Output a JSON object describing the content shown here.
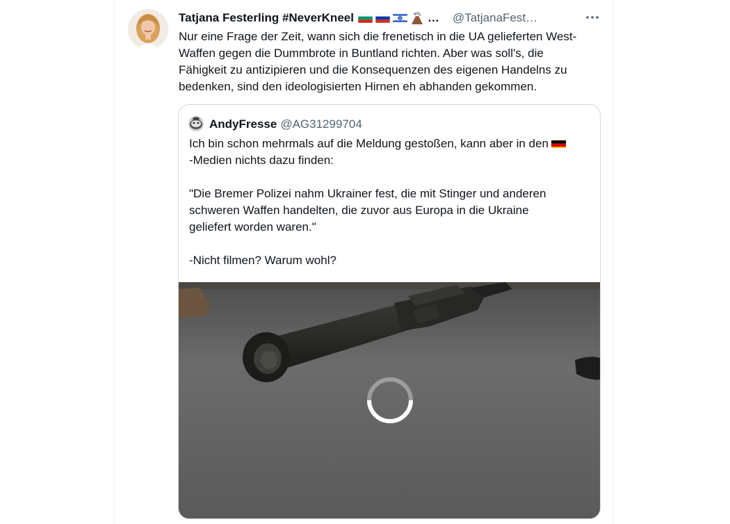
{
  "tweet": {
    "display_name": "Tatjana Festerling #NeverKneel",
    "name_suffix": "…",
    "handle": "@TatjanaFest…",
    "more_label": "···",
    "text_lines": [
      "Nur eine Frage der Zeit, wann sich die frenetisch in die UA gelieferten West-",
      "Waffen gegen die Dummbrote in Buntland richten. Aber was soll's, die",
      "Fähigkeit zu antizipieren und die Konsequenzen des eigenen Handelns zu",
      "bedenken, sind den ideologisierten Hirnen eh abhanden gekommen."
    ],
    "name_icons": [
      "flag-bulgaria-icon",
      "flag-russia-icon",
      "flag-israel-icon",
      "volcano-icon"
    ]
  },
  "quote": {
    "display_name": "AndyFresse",
    "handle": "@AG31299704",
    "lines": [
      "Ich bin schon mehrmals auf die Meldung gestoßen, kann aber in den",
      "-Medien nichts dazu finden:",
      "",
      "\"Die Bremer Polizei nahm Ukrainer fest, die mit Stinger und anderen",
      "schweren Waffen handelten, die zuvor aus Europa in die Ukraine",
      "geliefert worden waren.\"",
      "",
      "-Nicht filmen? Warum wohl?"
    ],
    "inline_icon": "flag-germany-icon",
    "media_icon": "loading-spinner-icon"
  },
  "colors": {
    "text": "#0f1419",
    "secondary": "#536471",
    "border": "#cfd9de"
  }
}
